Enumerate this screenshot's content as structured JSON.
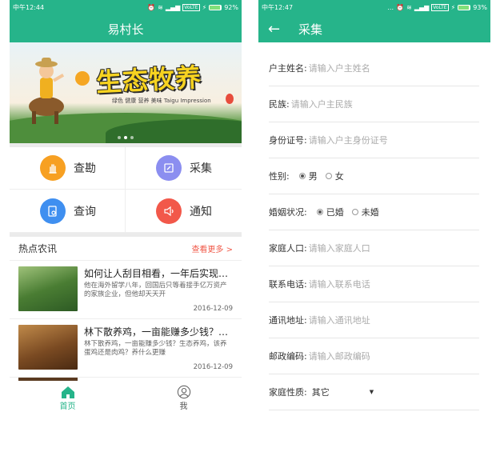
{
  "left": {
    "status": {
      "time": "中午12:44",
      "battery": "92%",
      "volte": "VoLTE",
      "battery_level": 0.92
    },
    "title": "易村长",
    "banner": {
      "title": "生态牧养",
      "subtitle": "绿色 健康 营养 美味   Taigu Impression"
    },
    "grid": [
      {
        "label": "查勘",
        "color": "#f7a022",
        "icon": "hand-icon"
      },
      {
        "label": "采集",
        "color": "#8b8ef0",
        "icon": "edit-icon"
      },
      {
        "label": "查询",
        "color": "#3f8ff0",
        "icon": "search-doc-icon"
      },
      {
        "label": "通知",
        "color": "#f2584a",
        "icon": "speaker-icon"
      }
    ],
    "news": {
      "header": "热点农讯",
      "more": "查看更多 >",
      "items": [
        {
          "title": "如何让人刮目相看，一年后实现年...",
          "desc": "他在海外留学八年，回国后只等着接手亿万资产的家族企业，但他却天天开",
          "date": "2016-12-09"
        },
        {
          "title": "林下散养鸡，一亩能赚多少钱？生...",
          "desc": "林下散养鸡，一亩能赚多少钱？生态养鸡，该养蛋鸡还是肉鸡？养什么更赚",
          "date": "2016-12-09"
        }
      ]
    },
    "tabs": [
      {
        "label": "首页",
        "icon": "home-icon"
      },
      {
        "label": "我",
        "icon": "user-icon"
      }
    ]
  },
  "right": {
    "status": {
      "time": "中午12:47",
      "battery": "93%",
      "volte": "VoLTE",
      "battery_level": 0.93
    },
    "back": "←",
    "title": "采集",
    "form": {
      "owner_name": {
        "label": "户主姓名:",
        "placeholder": "请输入户主姓名"
      },
      "ethnicity": {
        "label": "民族:",
        "placeholder": "请输入户主民族"
      },
      "id_number": {
        "label": "身份证号:",
        "placeholder": "请输入户主身份证号"
      },
      "gender": {
        "label": "性别:",
        "options": [
          "男",
          "女"
        ],
        "selected": "男"
      },
      "marital": {
        "label": "婚姻状况:",
        "options": [
          "已婚",
          "未婚"
        ],
        "selected": "已婚"
      },
      "population": {
        "label": "家庭人口:",
        "placeholder": "请输入家庭人口"
      },
      "phone": {
        "label": "联系电话:",
        "placeholder": "请输入联系电话"
      },
      "address": {
        "label": "通讯地址:",
        "placeholder": "请输入通讯地址"
      },
      "postcode": {
        "label": "邮政编码:",
        "placeholder": "请输入邮政编码"
      },
      "family_type": {
        "label": "家庭性质:",
        "value": "其它"
      }
    }
  }
}
